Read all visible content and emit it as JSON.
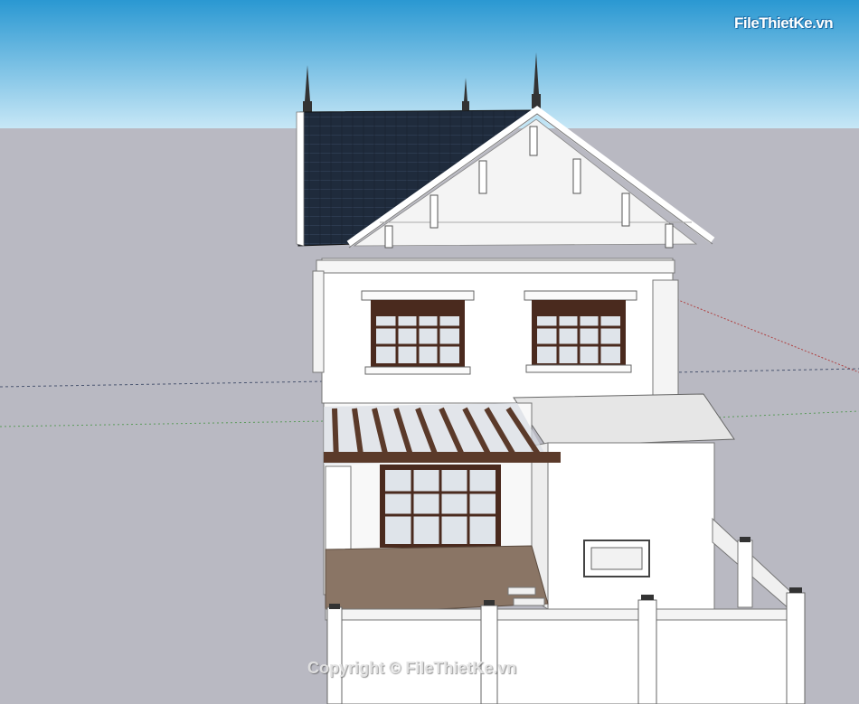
{
  "watermark": {
    "copyright_text": "Copyright © FileThietKe.vn"
  },
  "logo": {
    "text": "FileThietKe.vn"
  },
  "colors": {
    "sky_top": "#2a98d2",
    "sky_bottom": "#bfe4f5",
    "ground": "#b9b9c2",
    "roof": "#1f2b3c",
    "wall": "#ffffff",
    "trim": "#e8e8e8",
    "window_frame": "#4a2a1e",
    "pergola_wood": "#5b3a2a",
    "deck_floor": "#8a7565"
  }
}
